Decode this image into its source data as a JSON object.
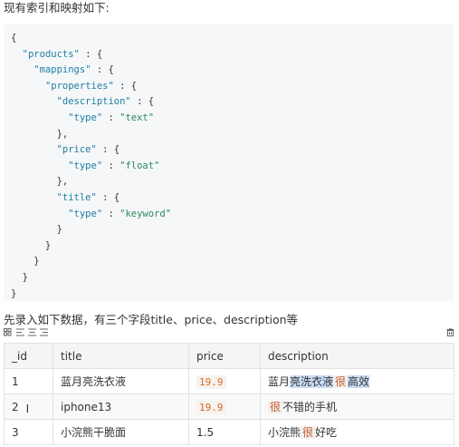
{
  "intro_text": "现有索引和映射如下:",
  "code_lines": [
    [
      {
        "t": "{",
        "c": ""
      }
    ],
    [
      {
        "t": "  ",
        "c": ""
      },
      {
        "t": "\"products\"",
        "c": "k"
      },
      {
        "t": " : {",
        "c": ""
      }
    ],
    [
      {
        "t": "    ",
        "c": ""
      },
      {
        "t": "\"mappings\"",
        "c": "k"
      },
      {
        "t": " : {",
        "c": ""
      }
    ],
    [
      {
        "t": "      ",
        "c": ""
      },
      {
        "t": "\"properties\"",
        "c": "k"
      },
      {
        "t": " : {",
        "c": ""
      }
    ],
    [
      {
        "t": "        ",
        "c": ""
      },
      {
        "t": "\"description\"",
        "c": "k"
      },
      {
        "t": " : {",
        "c": ""
      }
    ],
    [
      {
        "t": "          ",
        "c": ""
      },
      {
        "t": "\"type\"",
        "c": "k"
      },
      {
        "t": " : ",
        "c": ""
      },
      {
        "t": "\"text\"",
        "c": "s"
      }
    ],
    [
      {
        "t": "        },",
        "c": ""
      }
    ],
    [
      {
        "t": "        ",
        "c": ""
      },
      {
        "t": "\"price\"",
        "c": "k"
      },
      {
        "t": " : {",
        "c": ""
      }
    ],
    [
      {
        "t": "          ",
        "c": ""
      },
      {
        "t": "\"type\"",
        "c": "k"
      },
      {
        "t": " : ",
        "c": ""
      },
      {
        "t": "\"float\"",
        "c": "s"
      }
    ],
    [
      {
        "t": "        },",
        "c": ""
      }
    ],
    [
      {
        "t": "        ",
        "c": ""
      },
      {
        "t": "\"title\"",
        "c": "k"
      },
      {
        "t": " : {",
        "c": ""
      }
    ],
    [
      {
        "t": "          ",
        "c": ""
      },
      {
        "t": "\"type\"",
        "c": "k"
      },
      {
        "t": " : ",
        "c": ""
      },
      {
        "t": "\"keyword\"",
        "c": "s"
      }
    ],
    [
      {
        "t": "        }",
        "c": ""
      }
    ],
    [
      {
        "t": "      }",
        "c": ""
      }
    ],
    [
      {
        "t": "    }",
        "c": ""
      }
    ],
    [
      {
        "t": "  }",
        "c": ""
      }
    ],
    [
      {
        "t": "}",
        "c": ""
      }
    ]
  ],
  "second_text": "先录入如下数据，有三个字段title、price、description等",
  "toolbar": {
    "grid_icon": "table-grid-icon",
    "align_left_icon": "align-left-icon",
    "align_center_icon": "align-center-icon",
    "align_right_icon": "align-right-icon",
    "delete_icon": "trash-icon"
  },
  "table": {
    "headers": [
      "_id",
      "title",
      "price",
      "description"
    ],
    "rows": [
      {
        "id": "1",
        "title": "蓝月亮洗衣液",
        "price": "19.9",
        "price_code": true,
        "desc": [
          {
            "t": "蓝月",
            "s": ""
          },
          {
            "t": "亮洗衣液",
            "s": "hl"
          },
          {
            "t": "很",
            "s": "em"
          },
          {
            "t": "高效",
            "s": "hl"
          }
        ]
      },
      {
        "id": "2",
        "title": "iphone13",
        "price": "19.9",
        "price_code": true,
        "desc": [
          {
            "t": "很",
            "s": "em"
          },
          {
            "t": "不错的手机",
            "s": ""
          }
        ]
      },
      {
        "id": "3",
        "title": "小浣熊干脆面",
        "price": "1.5",
        "price_code": false,
        "desc": [
          {
            "t": "小浣熊",
            "s": ""
          },
          {
            "t": "很",
            "s": "em"
          },
          {
            "t": "好吃",
            "s": ""
          }
        ]
      }
    ]
  }
}
